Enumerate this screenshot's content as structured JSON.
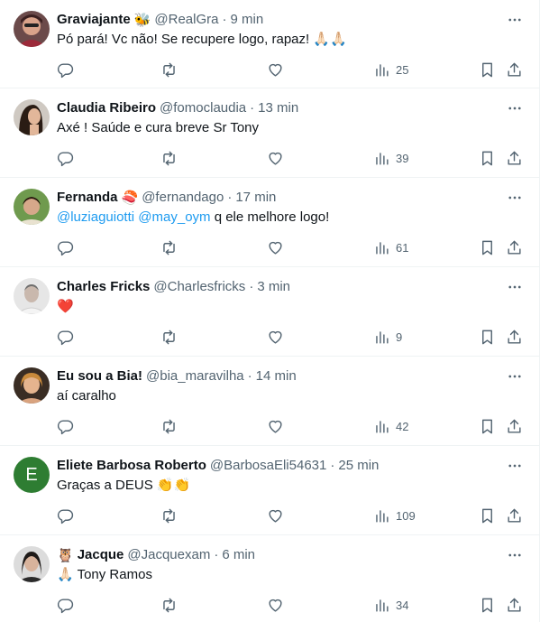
{
  "tweets": [
    {
      "name": "Graviajante",
      "badge": "🐝",
      "handle": "@RealGra",
      "sep": "·",
      "time": "9 min",
      "text": "Pó pará! Vc não! Se recupere logo, rapaz! 🙏🏻🙏🏻",
      "views": "25"
    },
    {
      "name": "Claudia Ribeiro",
      "badge": "",
      "handle": "@fomoclaudia",
      "sep": "·",
      "time": "13 min",
      "text": "Axé ! Saúde e cura breve Sr Tony",
      "views": "39"
    },
    {
      "name": "Fernanda",
      "badge": "🍣",
      "handle": "@fernandago",
      "sep": "·",
      "time": "17 min",
      "mention1": "@luziaguiotti",
      "mention2": "@may_oym",
      "text": "q ele melhore logo!",
      "views": "61"
    },
    {
      "name": "Charles Fricks",
      "badge": "",
      "handle": "@Charlesfricks",
      "sep": "·",
      "time": "3 min",
      "text": "❤️",
      "views": "9"
    },
    {
      "name": "Eu sou a Bia!",
      "badge": "",
      "handle": "@bia_maravilha",
      "sep": "·",
      "time": "14 min",
      "text": "aí caralho",
      "views": "42"
    },
    {
      "name": "Eliete Barbosa Roberto",
      "badge": "",
      "handle": "@BarbosaEli54631",
      "sep": "·",
      "time": "25 min",
      "avatar_letter": "E",
      "text": "Graças a DEUS 👏👏",
      "views": "109"
    },
    {
      "name": "Jacque",
      "badge_before": "🦉",
      "handle": "@Jacquexam",
      "sep": "·",
      "time": "6 min",
      "text": "🙏🏻 Tony Ramos",
      "views": "34"
    }
  ],
  "colors": {
    "text": "#0f1419",
    "secondary": "#536471",
    "link": "#1d9bf0",
    "divider": "#eff3f4"
  },
  "icons": [
    "reply-icon",
    "retweet-icon",
    "like-icon",
    "views-icon",
    "bookmark-icon",
    "share-icon",
    "more-icon"
  ]
}
